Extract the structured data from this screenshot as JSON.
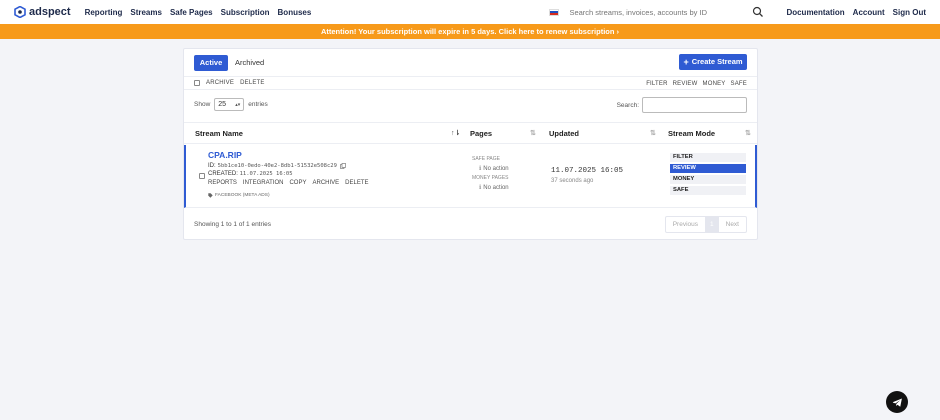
{
  "nav": {
    "brand": "adspect",
    "links": [
      "Reporting",
      "Streams",
      "Safe Pages",
      "Subscription",
      "Bonuses"
    ],
    "search_placeholder": "Search streams, invoices, accounts by ID",
    "right_links": [
      "Documentation",
      "Account",
      "Sign Out"
    ]
  },
  "banner": "Attention! Your subscription will expire in 5 days. Click here to renew subscription ›",
  "toolbar": {
    "active_label": "Active",
    "archived_label": "Archived",
    "create_label": "Create Stream"
  },
  "bulk": {
    "left": [
      "ARCHIVE",
      "DELETE"
    ],
    "right": [
      "FILTER",
      "REVIEW",
      "MONEY",
      "SAFE"
    ]
  },
  "table_controls": {
    "show_label": "Show",
    "entries_value": "25",
    "entries_label": "entries",
    "search_label": "Search:"
  },
  "columns": [
    "Stream Name",
    "Pages",
    "Updated",
    "Stream Mode"
  ],
  "row": {
    "name": "CPA.RIP",
    "id_label": "ID:",
    "id_value": "5bb1ce10-0edo-40e2-8db1-51532e508c29",
    "created_label": "CREATED:",
    "created_value": "11.07.2025 16:05",
    "actions": [
      "REPORTS",
      "INTEGRATION",
      "COPY",
      "ARCHIVE",
      "DELETE"
    ],
    "tag": "FACEBOOK (META ADS)",
    "safe_page_label": "SAFE PAGE",
    "safe_page_value": "No action",
    "money_pages_label": "MONEY PAGES",
    "money_pages_value": "No action",
    "updated": "11.07.2025 16:05",
    "updated_ago": "37 seconds ago",
    "modes": [
      "FILTER",
      "REVIEW",
      "MONEY",
      "SAFE"
    ],
    "selected_mode": "REVIEW"
  },
  "footer": {
    "info": "Showing 1 to 1 of 1 entries",
    "prev": "Previous",
    "page": "1",
    "next": "Next"
  },
  "colors": {
    "accent": "#2f5bd3",
    "banner": "#f79a1a",
    "background": "#f3f4f8"
  }
}
